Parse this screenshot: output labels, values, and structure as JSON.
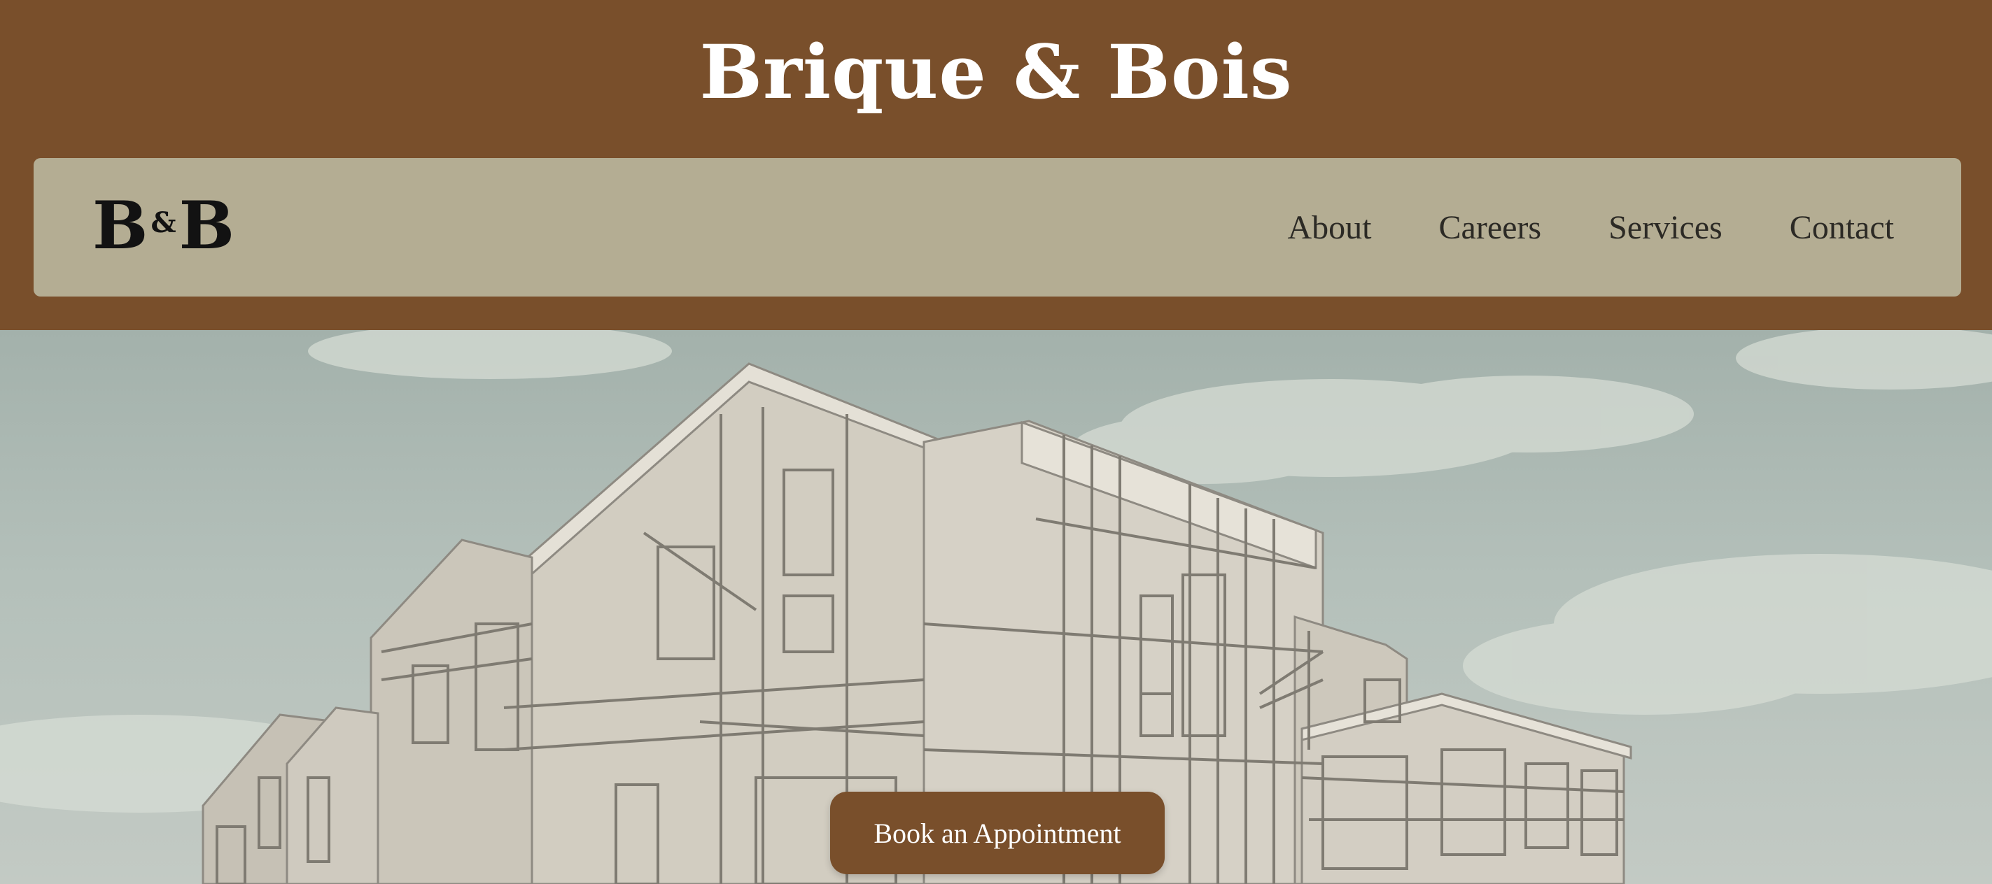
{
  "header": {
    "title": "Brique & Bois"
  },
  "navbar": {
    "logo": {
      "left": "B",
      "amp": "&",
      "right": "B"
    },
    "links": [
      {
        "label": "About"
      },
      {
        "label": "Careers"
      },
      {
        "label": "Services"
      },
      {
        "label": "Contact"
      }
    ]
  },
  "hero": {
    "cta_label": "Book an Appointment"
  },
  "colors": {
    "brand_brown": "#794f2b",
    "navbar_bg": "#b4ad93",
    "sky": "#a3b1ab"
  }
}
